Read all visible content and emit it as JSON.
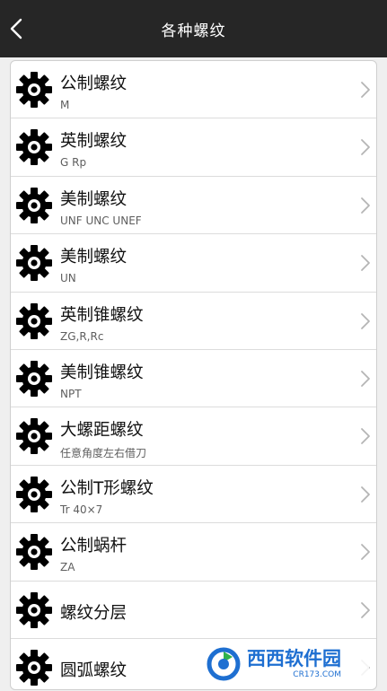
{
  "header": {
    "title": "各种螺纹",
    "back_icon": "chevron-left-icon"
  },
  "items": [
    {
      "label": "公制螺纹",
      "sub": "M"
    },
    {
      "label": "英制螺纹",
      "sub": "G Rp"
    },
    {
      "label": "美制螺纹",
      "sub": "UNF UNC UNEF"
    },
    {
      "label": "美制螺纹",
      "sub": "UN"
    },
    {
      "label": "英制锥螺纹",
      "sub": "ZG,R,Rc"
    },
    {
      "label": "美制锥螺纹",
      "sub": "NPT"
    },
    {
      "label": "大螺距螺纹",
      "sub": "任意角度左右借刀"
    },
    {
      "label": "公制T形螺纹",
      "sub": "Tr 40×7"
    },
    {
      "label": "公制蜗杆",
      "sub": "ZA"
    },
    {
      "label": "螺纹分层",
      "sub": ""
    },
    {
      "label": "圆弧螺纹",
      "sub": ""
    }
  ],
  "watermark": {
    "main": "西西软件园",
    "sub": "CR173.COM"
  },
  "colors": {
    "header_bg": "#262626",
    "page_bg": "#efefef",
    "icon": "#000000",
    "chevron": "#b5b5b5",
    "watermark": "#1e6fd1"
  }
}
